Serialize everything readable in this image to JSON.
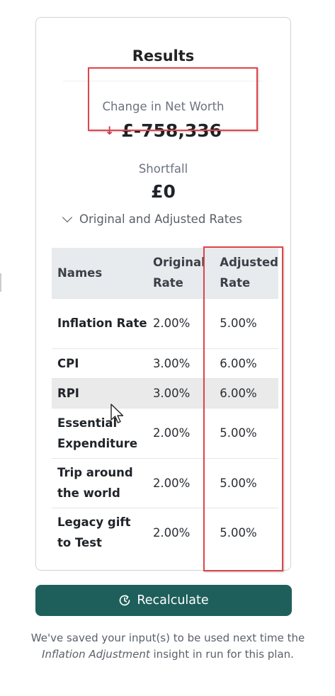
{
  "results": {
    "title": "Results",
    "change_in_net_worth_label": "Change in Net Worth",
    "change_in_net_worth_value": "£-758,336",
    "trend_icon": "down-arrow-icon",
    "shortfall_label": "Shortfall",
    "shortfall_value": "£0"
  },
  "rates_section": {
    "toggle_label": "Original and Adjusted Rates",
    "headers": [
      "Names",
      "Original Rate",
      "Adjusted Rate"
    ],
    "rows": [
      {
        "name": "Inflation Rate",
        "original": "2.00%",
        "adjusted": "5.00%"
      },
      {
        "name": "CPI",
        "original": "3.00%",
        "adjusted": "6.00%"
      },
      {
        "name": "RPI",
        "original": "3.00%",
        "adjusted": "6.00%"
      },
      {
        "name": "Essential Expenditure",
        "original": "2.00%",
        "adjusted": "5.00%"
      },
      {
        "name": "Trip around the world",
        "original": "2.00%",
        "adjusted": "5.00%"
      },
      {
        "name": "Legacy gift to Test",
        "original": "2.00%",
        "adjusted": "5.00%"
      }
    ]
  },
  "recalculate": {
    "label": "Recalculate",
    "icon": "refresh-clock-icon"
  },
  "note": {
    "part1": "We've saved your input(s) to be used next time the ",
    "insight_name": "Inflation Adjustment",
    "part2": " insight in run for this plan."
  },
  "colors": {
    "primary_button": "#1f5f5b",
    "down_arrow": "#d03a4e",
    "annotation": "#e2434a",
    "table_header_bg": "#e8ebee"
  }
}
